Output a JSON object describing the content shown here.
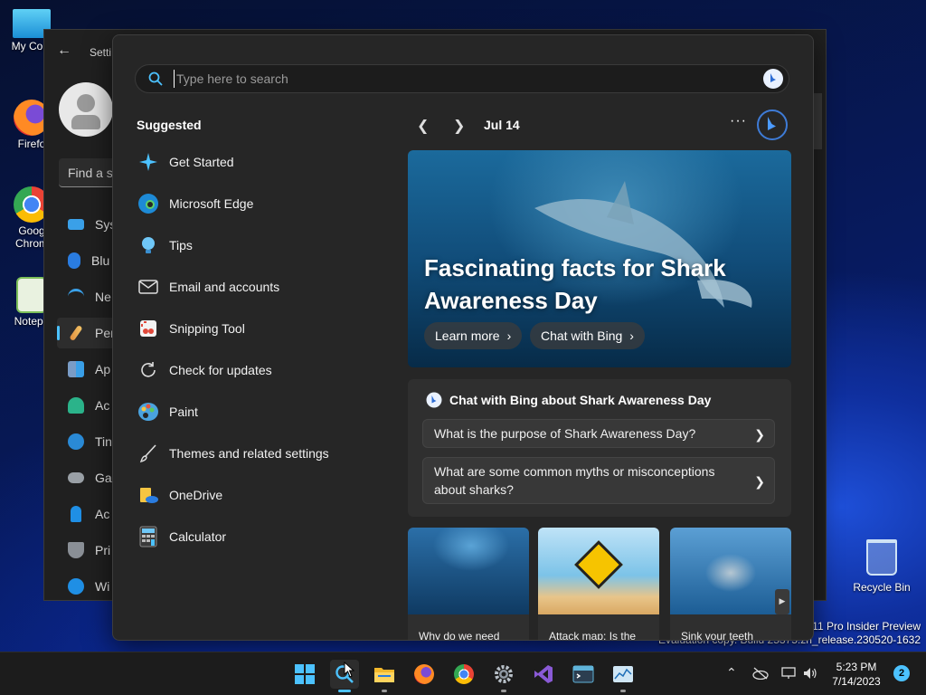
{
  "desktop": {
    "icons": [
      {
        "label": "My Com",
        "icon": "monitor-icon"
      },
      {
        "label": "Firefo",
        "icon": "firefox-icon"
      },
      {
        "label": "Goog Chrom",
        "icon": "chrome-icon"
      },
      {
        "label": "Notepa",
        "icon": "notepad-icon"
      }
    ],
    "recycle_bin": "Recycle Bin",
    "watermark_line1": "s 11 Pro Insider Preview",
    "watermark_line2": "Evaluation copy. Build 25375.zn_release.230520-1632"
  },
  "settings": {
    "title": "Setti",
    "find_placeholder": "Find a se",
    "nav": [
      {
        "label": "Sys",
        "icon": "system-icon"
      },
      {
        "label": "Blu",
        "icon": "bluetooth-icon"
      },
      {
        "label": "Ne",
        "icon": "network-icon"
      },
      {
        "label": "Per",
        "icon": "personalization-icon",
        "active": true
      },
      {
        "label": "Ap",
        "icon": "apps-icon"
      },
      {
        "label": "Ac",
        "icon": "accounts-icon"
      },
      {
        "label": "Tin",
        "icon": "time-icon"
      },
      {
        "label": "Ga",
        "icon": "gaming-icon"
      },
      {
        "label": "Ac",
        "icon": "accessibility-icon"
      },
      {
        "label": "Pri",
        "icon": "privacy-icon"
      },
      {
        "label": "Wi",
        "icon": "windows-update-icon"
      }
    ]
  },
  "flyout": {
    "search_placeholder": "Type here to search",
    "suggested_heading": "Suggested",
    "suggested": [
      {
        "label": "Get Started",
        "icon": "get-started-icon"
      },
      {
        "label": "Microsoft Edge",
        "icon": "edge-icon"
      },
      {
        "label": "Tips",
        "icon": "tips-icon"
      },
      {
        "label": "Email and accounts",
        "icon": "mail-icon"
      },
      {
        "label": "Snipping Tool",
        "icon": "snipping-tool-icon"
      },
      {
        "label": "Check for updates",
        "icon": "refresh-icon"
      },
      {
        "label": "Paint",
        "icon": "paint-icon"
      },
      {
        "label": "Themes and related settings",
        "icon": "brush-icon"
      },
      {
        "label": "OneDrive",
        "icon": "onedrive-icon"
      },
      {
        "label": "Calculator",
        "icon": "calculator-icon"
      }
    ],
    "date": "Jul 14",
    "hero": {
      "title": "Fascinating facts for Shark Awareness Day",
      "learn_more": "Learn more",
      "chat_with_bing": "Chat with Bing"
    },
    "chat": {
      "heading": "Chat with Bing about Shark Awareness Day",
      "questions": [
        "What is the purpose of Shark Awareness Day?",
        "What are some common myths or misconceptions about sharks?"
      ]
    },
    "tiles": [
      {
        "caption": "Why do we need"
      },
      {
        "caption": "Attack map: Is the"
      },
      {
        "caption": "Sink your teeth"
      }
    ]
  },
  "taskbar": {
    "apps": [
      "start-icon",
      "search-icon",
      "file-explorer-icon",
      "firefox-icon",
      "chrome-icon",
      "settings-icon",
      "visual-studio-icon",
      "terminal-icon",
      "task-manager-icon"
    ],
    "time": "5:23 PM",
    "date": "7/14/2023",
    "notifications": "2"
  },
  "colors": {
    "accent": "#4cc2ff",
    "flyout_bg": "#262626",
    "card_bg": "#2f2f2f"
  }
}
